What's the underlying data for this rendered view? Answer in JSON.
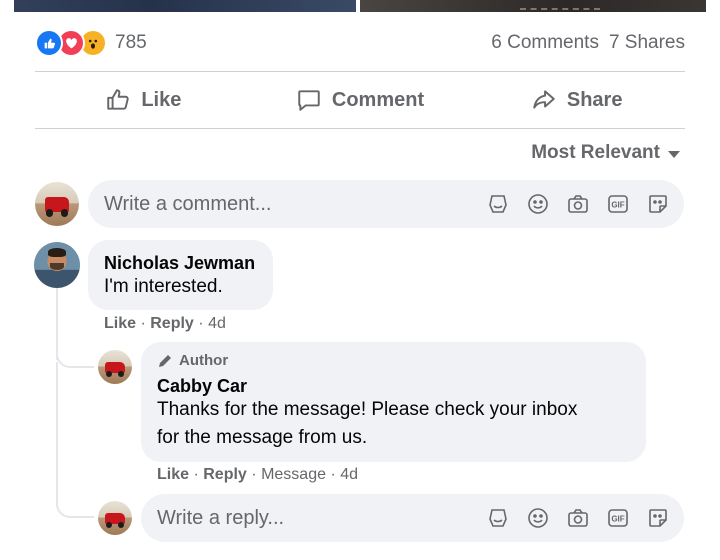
{
  "reactions": {
    "count": "785",
    "comments": "6 Comments",
    "shares": "7 Shares"
  },
  "actions": {
    "like": "Like",
    "comment": "Comment",
    "share": "Share"
  },
  "sort": {
    "label": "Most Relevant"
  },
  "composer": {
    "placeholder": "Write a comment..."
  },
  "comment": {
    "author": "Nicholas Jewman",
    "text": "I'm interested.",
    "like": "Like",
    "reply": "Reply",
    "time": "4d"
  },
  "reply": {
    "badge": "Author",
    "author": "Cabby Car",
    "text_line1": "Thanks for the message! Please check your inbox",
    "text_line2": "for the message from us.",
    "like": "Like",
    "reply": "Reply",
    "message": "Message",
    "time": "4d"
  },
  "reply_composer": {
    "placeholder": "Write a reply..."
  },
  "colors": {
    "like_blue": "#1877f2",
    "love_red": "#f33e58",
    "wow_yellow": "#f7b125",
    "meta_gray": "#65676b"
  }
}
